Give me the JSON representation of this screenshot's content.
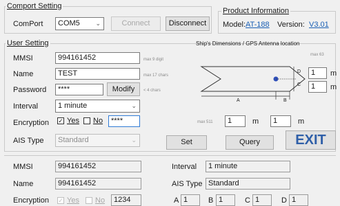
{
  "comport": {
    "title": "Comport Setting",
    "label": "ComPort",
    "port": "COM5",
    "connect": "Connect",
    "disconnect": "Disconnect"
  },
  "product": {
    "title": "Product Information",
    "model_label": "Model:",
    "model": "AT-188",
    "version_label": "Version:",
    "version": "V3.01"
  },
  "user": {
    "title": "User Setting",
    "mmsi_label": "MMSI",
    "mmsi": "994161452",
    "mmsi_hint": "max 9 digit",
    "name_label": "Name",
    "name": "TEST",
    "name_hint": "max 17 chars",
    "password_label": "Password",
    "password": "****",
    "modify": "Modify",
    "password_hint": "< 4 chars",
    "interval_label": "Interval",
    "interval": "1 minute",
    "encryption_label": "Encryption",
    "yes": "Yes",
    "no": "No",
    "encryption_key": "****",
    "ais_label": "AIS Type",
    "ais_type": "Standard"
  },
  "dims": {
    "title": "Ship's Dimensions / GPS Antenna location",
    "max63": "max 63",
    "max511": "max 511",
    "a_label": "A",
    "b_label": "B",
    "c_label": "C",
    "d_label": "D",
    "d_value": "1",
    "c_value": "1",
    "a_value": "1",
    "b_value": "1",
    "unit": "m"
  },
  "actions": {
    "set": "Set",
    "query": "Query",
    "exit": "EXIT"
  },
  "status": {
    "mmsi_label": "MMSI",
    "mmsi": "994161452",
    "interval_label": "Interval",
    "interval": "1 minute",
    "name_label": "Name",
    "name": "994161452",
    "ais_label": "AIS Type",
    "ais_type": "Standard",
    "encryption_label": "Encryption",
    "yes": "Yes",
    "no": "No",
    "enc_key": "1234",
    "a_label": "A",
    "a": "1",
    "b_label": "B",
    "b": "1",
    "c_label": "C",
    "c": "1",
    "d_label": "D",
    "d": "1"
  },
  "colors": {
    "accent": "#2f7bd6",
    "exit": "#2f5fa8",
    "link": "#1a5fb4",
    "gps_dot": "#2f4fb8"
  }
}
